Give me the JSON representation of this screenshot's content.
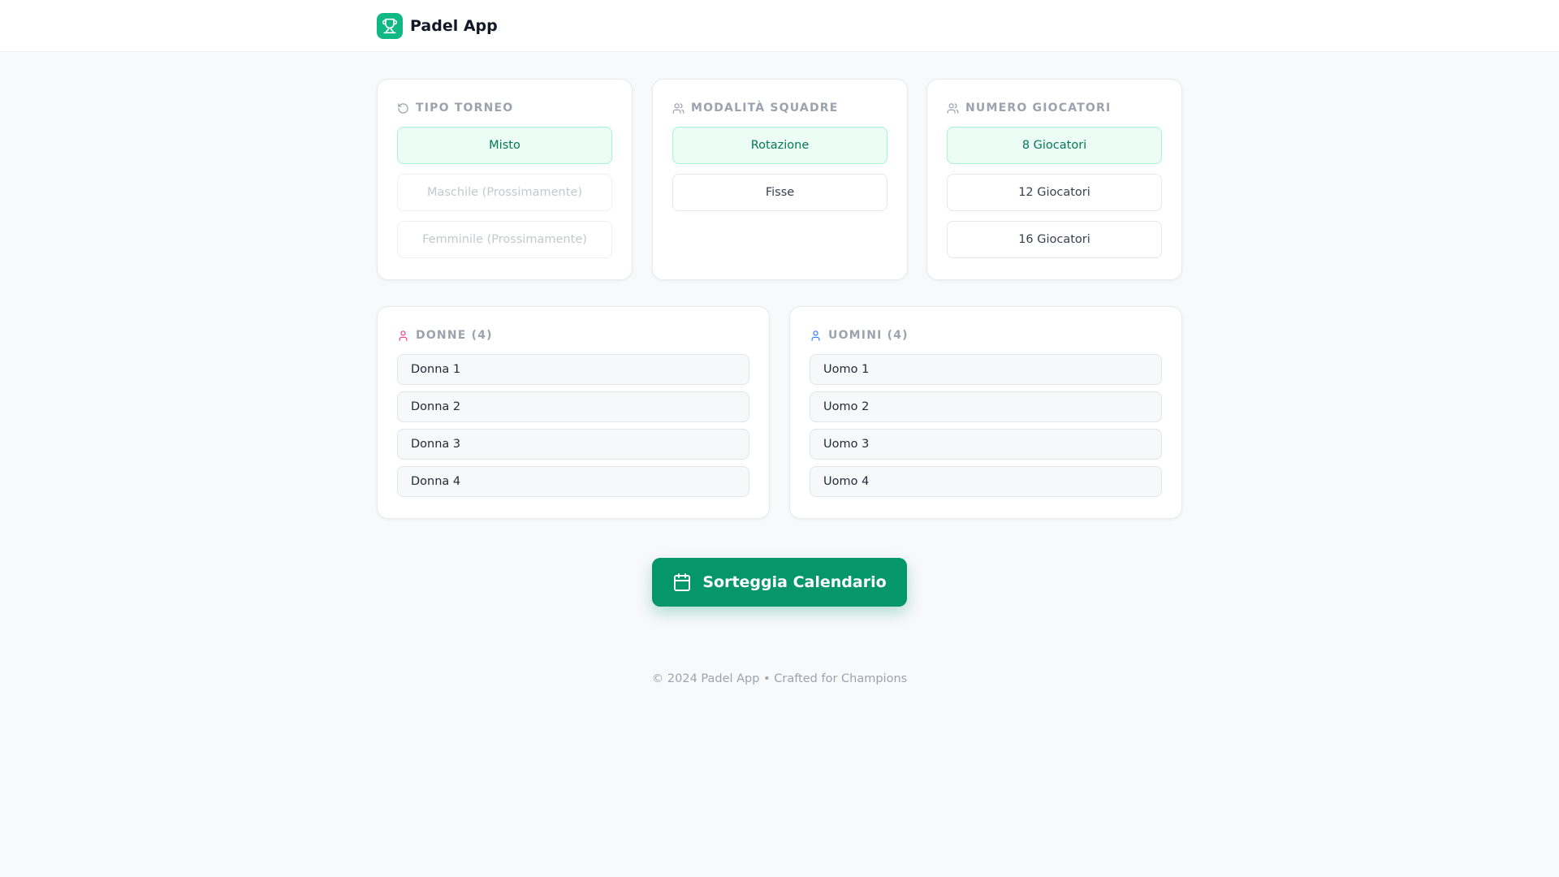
{
  "header": {
    "app_name": "Padel App",
    "logo_icon": "trophy-icon"
  },
  "tournament_type": {
    "title": "TIPO TORNEO",
    "icon": "rotate-ccw-icon",
    "options": [
      "Misto",
      "Maschile (Prossimamente)",
      "Femminile (Prossimamente)"
    ],
    "selected": "Misto"
  },
  "team_mode": {
    "title": "MODALITÀ SQUADRE",
    "icon": "users-icon",
    "options": [
      "Rotazione",
      "Fisse"
    ],
    "selected": "Rotazione"
  },
  "player_count": {
    "title": "NUMERO GIOCATORI",
    "icon": "users-icon",
    "options": [
      "8 Giocatori",
      "12 Giocatori",
      "16 Giocatori"
    ],
    "selected": "8 Giocatori"
  },
  "women": {
    "title": "DONNE (4)",
    "icon": "user-icon",
    "icon_color": "#ec4899",
    "players": [
      "Donna 1",
      "Donna 2",
      "Donna 3",
      "Donna 4"
    ]
  },
  "men": {
    "title": "UOMINI (4)",
    "icon": "user-icon",
    "icon_color": "#3b82f6",
    "players": [
      "Uomo 1",
      "Uomo 2",
      "Uomo 3",
      "Uomo 4"
    ]
  },
  "cta": {
    "label": "Sorteggia Calendario",
    "icon": "calendar-icon"
  },
  "footer": {
    "text": "© 2024 Padel App • Crafted for Champions"
  },
  "colors": {
    "accent": "#059669",
    "logo": "#10b981",
    "selected_bg": "#ecfdf5"
  }
}
